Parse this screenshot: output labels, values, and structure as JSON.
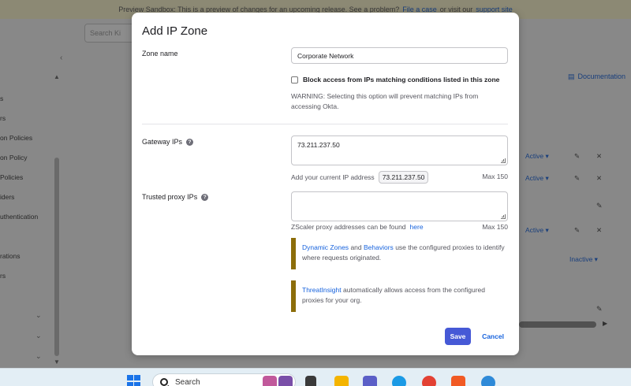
{
  "background": {
    "banner": {
      "text": "Preview Sandbox: This is a preview of changes for an upcoming release. See a problem?",
      "link1": "File a case",
      "middle": "or visit our",
      "link2": "support site"
    },
    "search_placeholder": "Search Ki",
    "sidebar_items": [
      "s",
      "rs",
      "on Policies",
      "on Policy",
      "Policies",
      "iders",
      "uthentication",
      "rations",
      "rs"
    ],
    "documentation_link": "Documentation",
    "zone_rows": [
      {
        "status": "Active"
      },
      {
        "status": "Active"
      },
      {
        "status": "Active"
      }
    ],
    "inactive_status": "Inactive"
  },
  "modal": {
    "title": "Add IP Zone",
    "zone_name": {
      "label": "Zone name",
      "value": "Corporate Network"
    },
    "block_access": {
      "label": "Block access from IPs matching conditions listed in this zone",
      "checked": false,
      "warning": "WARNING: Selecting this option will prevent matching IPs from accessing Okta."
    },
    "gateway_ips": {
      "label": "Gateway IPs",
      "value": "73.211.237.50",
      "hint": "Add your current IP address",
      "current_ip": "73.211.237.50",
      "max": "Max 150"
    },
    "trusted_proxy_ips": {
      "label": "Trusted proxy IPs",
      "value": "",
      "hint": "ZScaler proxy addresses can be found",
      "hint_link": "here",
      "max": "Max 150"
    },
    "callout_1": {
      "link1": "Dynamic Zones",
      "and": "and",
      "link2": "Behaviors",
      "text": "use the configured proxies to identify where requests originated."
    },
    "callout_2": {
      "link": "ThreatInsight",
      "text": "automatically allows access from the configured proxies for your org."
    },
    "save_label": "Save",
    "cancel_label": "Cancel"
  },
  "taskbar": {
    "search_label": "Search"
  },
  "colors": {
    "primary_button": "#4659d6",
    "link": "#1662dd",
    "callout_bar": "#8c6d0a"
  }
}
